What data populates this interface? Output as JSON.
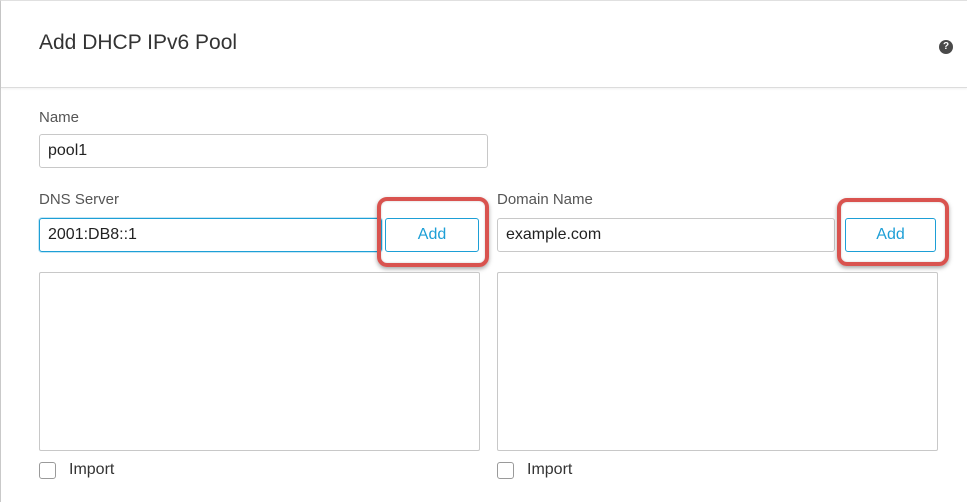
{
  "dialog": {
    "title": "Add DHCP IPv6 Pool",
    "help_icon": "help-circle-icon",
    "help_glyph": "?"
  },
  "name": {
    "label": "Name",
    "value": "pool1"
  },
  "dns_server": {
    "label": "DNS Server",
    "value": "2001:DB8::1",
    "add_label": "Add",
    "import_label": "Import"
  },
  "domain_name": {
    "label": "Domain Name",
    "value": "example.com",
    "add_label": "Add",
    "import_label": "Import"
  },
  "colors": {
    "accent": "#1d9fd6",
    "highlight": "#d9534f"
  }
}
